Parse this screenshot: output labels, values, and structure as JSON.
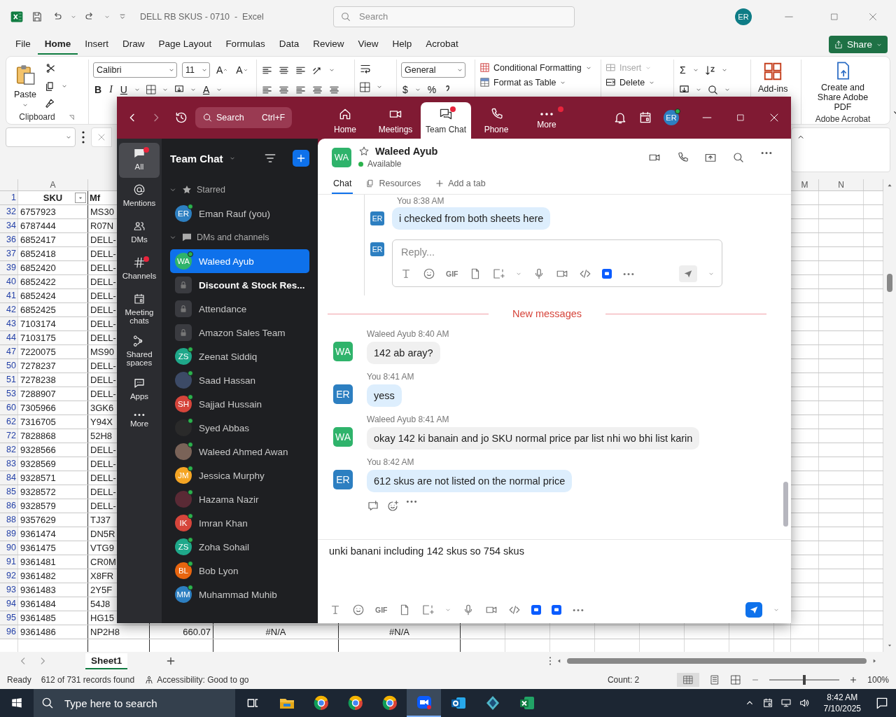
{
  "excel": {
    "title": "DELL RB SKUS - 0710  -  Excel",
    "search": {
      "placeholder": "Search"
    },
    "account": "ER",
    "share": "Share",
    "menu": [
      {
        "label": "File",
        "selected": false
      },
      {
        "label": "Home",
        "selected": true
      },
      {
        "label": "Insert",
        "selected": false
      },
      {
        "label": "Draw",
        "selected": false
      },
      {
        "label": "Page Layout",
        "selected": false
      },
      {
        "label": "Formulas",
        "selected": false
      },
      {
        "label": "Data",
        "selected": false
      },
      {
        "label": "Review",
        "selected": false
      },
      {
        "label": "View",
        "selected": false
      },
      {
        "label": "Help",
        "selected": false
      },
      {
        "label": "Acrobat",
        "selected": false
      }
    ],
    "ribbon": {
      "paste": "Paste",
      "font": "Calibri",
      "size": "11",
      "grow_font": "A",
      "shrink_font": "A",
      "bold": "B",
      "italic": "I",
      "underline": "U",
      "font_color": "A",
      "number_format": "General",
      "currency": "$",
      "percent": "%",
      "conditional_formatting": "Conditional Formatting",
      "format_as_table": "Format as Table",
      "insert": {
        "label": "Insert",
        "disabled": true
      },
      "delete": "Delete",
      "sum": "Σ",
      "add_ins": "Add-ins",
      "create_pdf": "Create and Share Adobe PDF",
      "groups": [
        "Clipboard",
        "Adobe Acrobat"
      ]
    },
    "column_headers": [
      "A",
      "M",
      "N"
    ],
    "header_row": {
      "number": "1",
      "cells": [
        "SKU",
        "Mf"
      ]
    },
    "rows": [
      {
        "number": "32",
        "cells": [
          "6757923",
          "MS30"
        ]
      },
      {
        "number": "34",
        "cells": [
          "6787444",
          "R07N"
        ]
      },
      {
        "number": "36",
        "cells": [
          "6852417",
          "DELL-"
        ]
      },
      {
        "number": "37",
        "cells": [
          "6852418",
          "DELL-"
        ]
      },
      {
        "number": "39",
        "cells": [
          "6852420",
          "DELL-"
        ]
      },
      {
        "number": "40",
        "cells": [
          "6852422",
          "DELL-"
        ]
      },
      {
        "number": "41",
        "cells": [
          "6852424",
          "DELL-"
        ]
      },
      {
        "number": "42",
        "cells": [
          "6852425",
          "DELL-"
        ]
      },
      {
        "number": "43",
        "cells": [
          "7103174",
          "DELL-"
        ]
      },
      {
        "number": "44",
        "cells": [
          "7103175",
          "DELL-"
        ]
      },
      {
        "number": "47",
        "cells": [
          "7220075",
          "MS90"
        ]
      },
      {
        "number": "50",
        "cells": [
          "7278237",
          "DELL-"
        ]
      },
      {
        "number": "51",
        "cells": [
          "7278238",
          "DELL-"
        ]
      },
      {
        "number": "53",
        "cells": [
          "7288907",
          "DELL-"
        ]
      },
      {
        "number": "60",
        "cells": [
          "7305966",
          "3GK6"
        ]
      },
      {
        "number": "62",
        "cells": [
          "7316705",
          "Y94X"
        ]
      },
      {
        "number": "72",
        "cells": [
          "7828868",
          "52H8"
        ]
      },
      {
        "number": "82",
        "cells": [
          "9328566",
          "DELL-"
        ]
      },
      {
        "number": "83",
        "cells": [
          "9328569",
          "DELL-"
        ]
      },
      {
        "number": "84",
        "cells": [
          "9328571",
          "DELL-"
        ]
      },
      {
        "number": "85",
        "cells": [
          "9328572",
          "DELL-"
        ]
      },
      {
        "number": "86",
        "cells": [
          "9328579",
          "DELL-"
        ]
      },
      {
        "number": "88",
        "cells": [
          "9357629",
          "TJ37"
        ]
      },
      {
        "number": "89",
        "cells": [
          "9361474",
          "DN5R"
        ]
      },
      {
        "number": "90",
        "cells": [
          "9361475",
          "VTG9"
        ]
      },
      {
        "number": "91",
        "cells": [
          "9361481",
          "CR0M"
        ]
      },
      {
        "number": "92",
        "cells": [
          "9361482",
          "X8FR"
        ]
      },
      {
        "number": "93",
        "cells": [
          "9361483",
          "2Y5F"
        ]
      },
      {
        "number": "94",
        "cells": [
          "9361484",
          "54J8"
        ]
      },
      {
        "number": "95",
        "cells": [
          "9361485",
          "HG15"
        ]
      },
      {
        "number": "96",
        "cells": [
          "9361486",
          "NP2H8",
          "660.07",
          "#N/A",
          "#N/A"
        ]
      }
    ],
    "sheet_tabs": [
      {
        "label": "Sheet1",
        "selected": true
      }
    ],
    "status": {
      "ready": "Ready",
      "records": "612 of 731 records found",
      "accessibility": "Accessibility: Good to go",
      "count": "Count: 2",
      "zoom": {
        "level": 0.5
      },
      "zoom_percent": "100%"
    }
  },
  "zoom": {
    "nav": {
      "search": {
        "placeholder": "Search"
      },
      "shortcut": "Ctrl+F",
      "account": "ER",
      "tabs": [
        {
          "label": "Home",
          "kind": "home",
          "selected": false,
          "badge": false
        },
        {
          "label": "Meetings",
          "kind": "meetings",
          "selected": false,
          "badge": false
        },
        {
          "label": "Team Chat",
          "kind": "chat",
          "selected": true,
          "badge": true
        },
        {
          "label": "Phone",
          "kind": "phone",
          "selected": false,
          "badge": false
        },
        {
          "label": "More",
          "kind": "more",
          "selected": false,
          "badge": true
        }
      ]
    },
    "rail": [
      {
        "label": "All",
        "kind": "all",
        "selected": true,
        "badge": true
      },
      {
        "label": "Mentions",
        "kind": "mentions",
        "selected": false,
        "badge": false
      },
      {
        "label": "DMs",
        "kind": "dms",
        "selected": false,
        "badge": false
      },
      {
        "label": "Channels",
        "kind": "channels",
        "selected": false,
        "badge": true
      },
      {
        "label": "Meeting chats",
        "kind": "meetings",
        "selected": false,
        "badge": false
      },
      {
        "label": "Shared spaces",
        "kind": "spaces",
        "selected": false,
        "badge": false
      },
      {
        "label": "Apps",
        "kind": "apps",
        "selected": false,
        "badge": false
      },
      {
        "label": "More",
        "kind": "more",
        "selected": false,
        "badge": false
      }
    ],
    "list": {
      "title": "Team Chat",
      "sections": [
        {
          "label": "Starred",
          "kind": "starred",
          "expanded": true,
          "items": [
            {
              "name": "Eman Rauf (you)",
              "kind": "initials",
              "initials": "ER",
              "color": "#2d7fc1",
              "online": true,
              "selected": false,
              "unread": false
            }
          ]
        },
        {
          "label": "DMs and channels",
          "kind": "dms",
          "expanded": true,
          "items": [
            {
              "name": "Waleed Ayub",
              "kind": "initials",
              "initials": "WA",
              "color": "#2fb36b",
              "online": true,
              "selected": true,
              "unread": false
            },
            {
              "name": "Discount & Stock Res...",
              "kind": "channel",
              "color": "#3a3b40",
              "online": false,
              "selected": false,
              "unread": true
            },
            {
              "name": "Attendance",
              "kind": "channel",
              "color": "#3a3b40",
              "online": false,
              "selected": false,
              "unread": false
            },
            {
              "name": "Amazon Sales Team",
              "kind": "channel",
              "color": "#3a3b40",
              "online": false,
              "selected": false,
              "unread": false
            },
            {
              "name": "Zeenat Siddiq",
              "kind": "initials",
              "initials": "ZS",
              "color": "#1fa88a",
              "online": true,
              "selected": false,
              "unread": false
            },
            {
              "name": "Saad Hassan",
              "kind": "photo",
              "color": "#3c4a66",
              "online": true,
              "selected": false,
              "unread": false
            },
            {
              "name": "Sajjad Hussain",
              "kind": "initials",
              "initials": "SH",
              "color": "#d6453b",
              "online": true,
              "selected": false,
              "unread": false
            },
            {
              "name": "Syed Abbas",
              "kind": "photo",
              "color": "#2a2a2a",
              "online": true,
              "selected": false,
              "unread": false
            },
            {
              "name": "Waleed Ahmed Awan",
              "kind": "photo",
              "color": "#7a6358",
              "online": true,
              "selected": false,
              "unread": false
            },
            {
              "name": "Jessica Murphy",
              "kind": "initials",
              "initials": "JM",
              "color": "#f5a524",
              "online": true,
              "selected": false,
              "unread": false
            },
            {
              "name": "Hazama Nazir",
              "kind": "photo",
              "color": "#5a2a35",
              "online": true,
              "selected": false,
              "unread": false
            },
            {
              "name": "Imran Khan",
              "kind": "initials",
              "initials": "IK",
              "color": "#d6453b",
              "online": true,
              "selected": false,
              "unread": false
            },
            {
              "name": "Zoha Sohail",
              "kind": "initials",
              "initials": "ZS",
              "color": "#1fa88a",
              "online": true,
              "selected": false,
              "unread": false
            },
            {
              "name": "Bob Lyon",
              "kind": "initials",
              "initials": "BL",
              "color": "#e8650f",
              "online": true,
              "selected": false,
              "unread": false
            },
            {
              "name": "Muhammad Muhib",
              "kind": "initials",
              "initials": "MM",
              "color": "#2d7fc1",
              "online": true,
              "selected": false,
              "unread": false
            }
          ]
        }
      ]
    },
    "chat": {
      "name": "Waleed Ayub",
      "initials": "WA",
      "presence": "Available",
      "starred": false,
      "tabs": [
        {
          "label": "Chat",
          "kind": "chat",
          "selected": true
        },
        {
          "label": "Resources",
          "kind": "resources",
          "selected": false
        },
        {
          "label": "Add a tab",
          "kind": "add",
          "selected": false
        }
      ],
      "thread": {
        "sender": "You",
        "time": "8:38 AM",
        "initials": "ER",
        "text": "i checked from both sheets here",
        "reply": {
          "initials": "ER",
          "placeholder": "Reply...",
          "gif": "GIF"
        }
      },
      "divider": "New messages",
      "messages": [
        {
          "sender": "Waleed Ayub",
          "time": "8:40 AM",
          "initials": "WA",
          "mine": false,
          "text": "142 ab aray?"
        },
        {
          "sender": "You",
          "time": "8:41 AM",
          "initials": "ER",
          "mine": true,
          "text": "yess"
        },
        {
          "sender": "Waleed Ayub",
          "time": "8:41 AM",
          "initials": "WA",
          "mine": false,
          "text": "okay 142 ki banain and jo SKU normal price par list nhi wo bhi list karin"
        },
        {
          "sender": "You",
          "time": "8:42 AM",
          "initials": "ER",
          "mine": true,
          "text": "612 skus are not listed on the normal price"
        }
      ],
      "composer": {
        "value": "unki banani including 142 skus so 754 skus ",
        "gif": "GIF"
      }
    }
  },
  "taskbar": {
    "search": {
      "placeholder": "Type here to search"
    },
    "time": "8:42 AM",
    "date": "7/10/2025",
    "apps": [
      {
        "kind": "folder",
        "active": false
      },
      {
        "kind": "browser",
        "active": false
      },
      {
        "kind": "browser",
        "active": false
      },
      {
        "kind": "browser",
        "active": false
      },
      {
        "kind": "zoom",
        "active": true
      },
      {
        "kind": "mail",
        "active": false
      },
      {
        "kind": "diamond",
        "active": false
      },
      {
        "kind": "sheet",
        "active": false
      }
    ]
  }
}
